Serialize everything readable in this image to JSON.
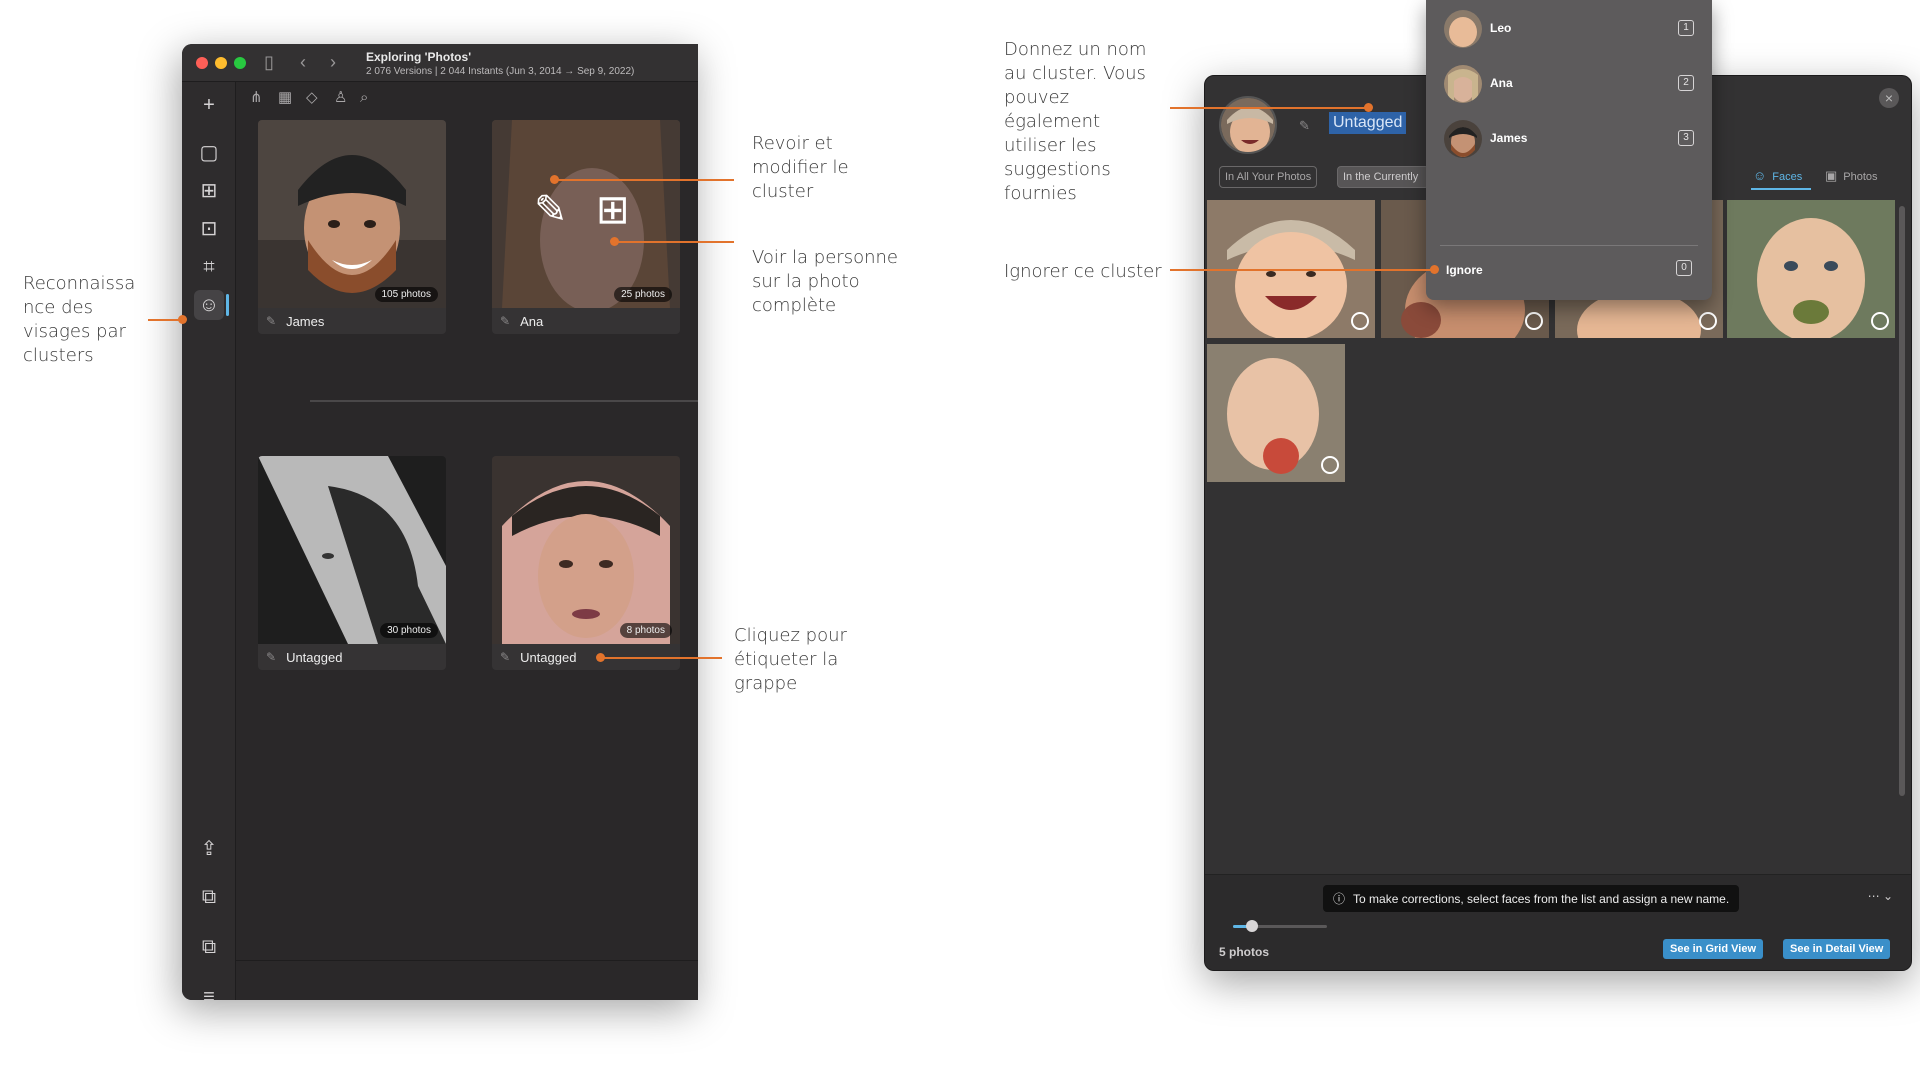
{
  "window": {
    "title": "Exploring 'Photos'",
    "subtitle": "2 076 Versions | 2 044 Instants (Jun 3, 2014 → Sep 9, 2022)"
  },
  "clusters": [
    {
      "name": "James",
      "count": "105 photos"
    },
    {
      "name": "Ana",
      "count": "25 photos"
    },
    {
      "name": "Untagged",
      "count": "30 photos"
    },
    {
      "name": "Untagged",
      "count": "8 photos"
    }
  ],
  "annotations": {
    "face_recognition": "Reconnaissa nce des visages par clusters",
    "review_edit": "Revoir et modifier le cluster",
    "see_full_photo": "Voir la personne sur la photo complète",
    "click_to_tag": "Cliquez pour étiqueter la grappe",
    "name_cluster": "Donnez un nom au cluster. Vous pouvez également utiliser les suggestions fournies",
    "ignore_cluster": "Ignorer ce cluster"
  },
  "detail": {
    "name_value": "Untagged",
    "scope_all": "In All Your Photos",
    "scope_current": "In the Currently",
    "tab_faces": "Faces",
    "tab_photos": "Photos",
    "hint": "To make corrections, select faces from the list and assign a new name.",
    "more": "⋯ ⌄",
    "count": "5 photos",
    "slider_level": 0.2,
    "btn_grid": "See in Grid View",
    "btn_detail": "See in Detail View"
  },
  "suggestions": [
    {
      "name": "Leo",
      "key": "1"
    },
    {
      "name": "Ana",
      "key": "2"
    },
    {
      "name": "James",
      "key": "3"
    }
  ],
  "ignore": {
    "label": "Ignore",
    "key": "0"
  },
  "icons": {
    "add": "+",
    "close": "×",
    "info": "ⓘ",
    "edit": "✎"
  },
  "colors": {
    "accent": "#5fb6e6",
    "annotation": "#e2732c",
    "button": "#3a8fc9"
  }
}
